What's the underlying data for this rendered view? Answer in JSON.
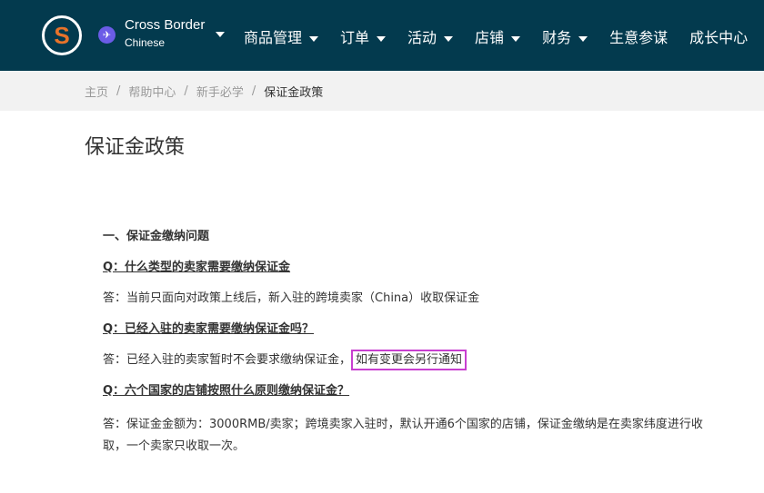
{
  "header": {
    "logo_letter": "S",
    "account_name": "Cross Border",
    "account_sub": "Chinese",
    "nav": [
      "商品管理",
      "订单",
      "活动",
      "店铺",
      "财务",
      "生意参谋",
      "成长中心"
    ],
    "nav_has_caret": [
      true,
      true,
      true,
      true,
      true,
      false,
      false
    ]
  },
  "breadcrumb": [
    "主页",
    "帮助中心",
    "新手必学",
    "保证金政策"
  ],
  "page_title": "保证金政策",
  "content": {
    "section": "一、保证金缴纳问题",
    "q1": "Q：什么类型的卖家需要缴纳保证金",
    "a1": "答：当前只面向对政策上线后，新入驻的跨境卖家（China）收取保证金",
    "q2": "Q：已经入驻的卖家需要缴纳保证金吗？",
    "a2": "答：已经入驻的卖家暂时不会要求缴纳保证金，",
    "a2_highlight": "如有变更会另行通知",
    "q3": "Q：六个国家的店铺按照什么原则缴纳保证金？",
    "a3": "答：保证金金额为：3000RMB/卖家；跨境卖家入驻时，默认开通6个国家的店铺，保证金缴纳是在卖家纬度进行收取，一个卖家只收取一次。"
  },
  "colors": {
    "header_bg": "#033a4e",
    "highlight": "#c83fd0"
  }
}
